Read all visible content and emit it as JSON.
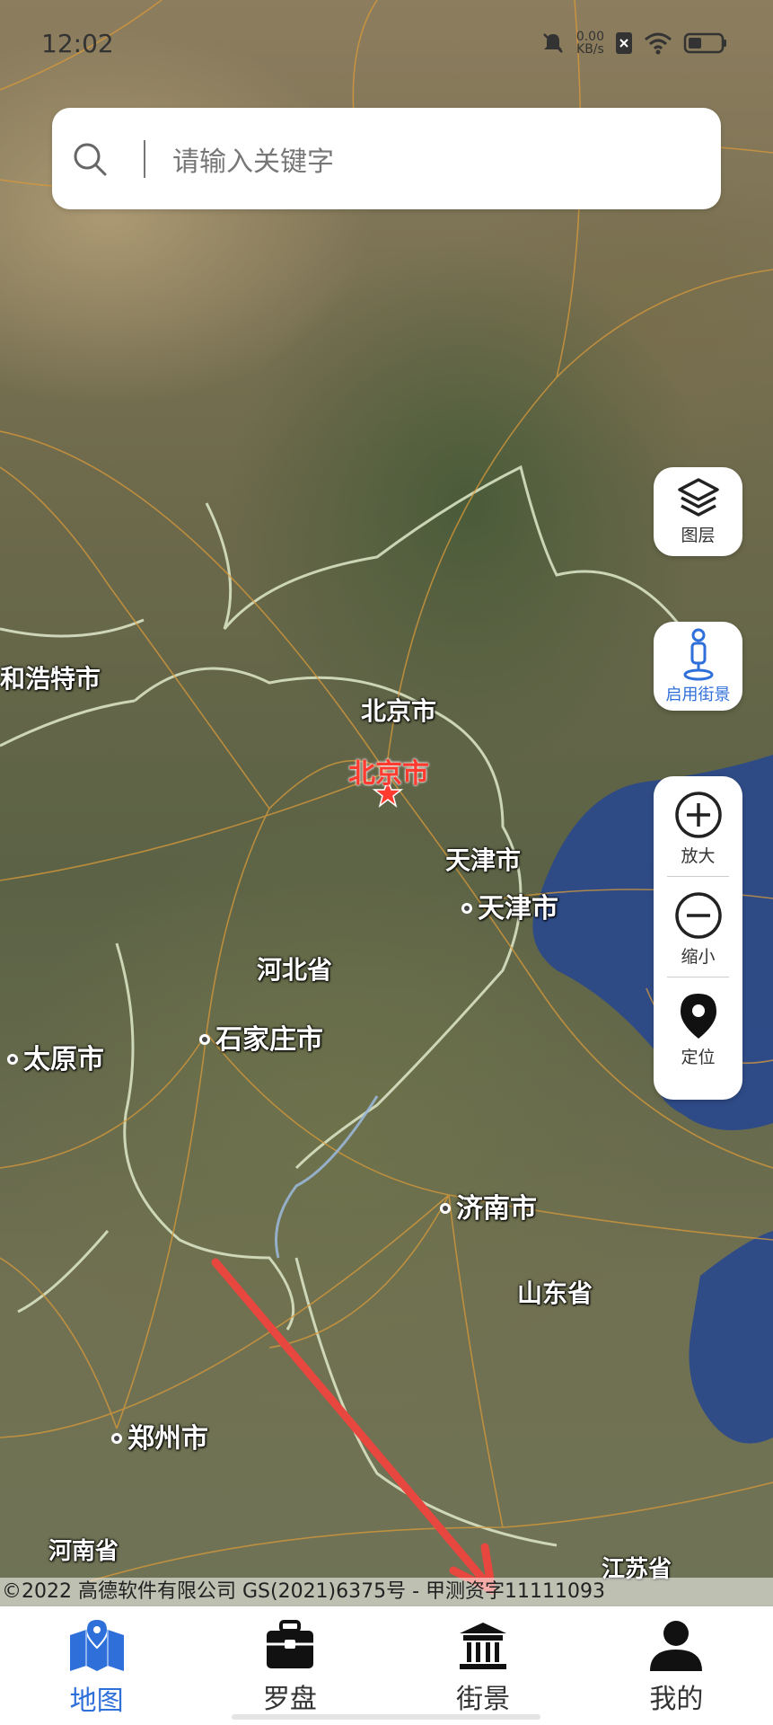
{
  "status_bar": {
    "time": "12:02",
    "net_speed_value": "0.00",
    "net_speed_unit": "KB/s",
    "battery_level": 0.3
  },
  "search": {
    "placeholder": "请输入关键字",
    "icon": "search-icon"
  },
  "map": {
    "labels": {
      "huhehaote": "和浩特市",
      "beijing_region": "北京市",
      "beijing_capital": "北京市",
      "tianjin_region": "天津市",
      "tianjin_city": "天津市",
      "hebei": "河北省",
      "shijiazhuang": "石家庄市",
      "taiyuan": "太原市",
      "jinan": "济南市",
      "shandong": "山东省",
      "zhengzhou": "郑州市",
      "henan": "河南省",
      "jiangsu": "江苏省"
    },
    "annotation_color": "#e8473f",
    "capital_color": "#ff3b30",
    "sea_color": "#2c4a8a"
  },
  "controls": {
    "layers": {
      "label": "图层",
      "icon": "layers-icon"
    },
    "street_view": {
      "label": "启用街景",
      "icon": "person-pin-icon",
      "color": "#2f6fd9"
    },
    "zoom_in": {
      "label": "放大",
      "icon": "plus-circle-icon"
    },
    "zoom_out": {
      "label": "缩小",
      "icon": "minus-circle-icon"
    },
    "locate": {
      "label": "定位",
      "icon": "location-pin-icon"
    }
  },
  "copyright": "©2022 高德软件有限公司 GS(2021)6375号 - 甲测资字11111093",
  "tabs": [
    {
      "label": "地图",
      "icon": "map-icon",
      "active": true
    },
    {
      "label": "罗盘",
      "icon": "toolbox-icon",
      "active": false
    },
    {
      "label": "街景",
      "icon": "temple-gate-icon",
      "active": false
    },
    {
      "label": "我的",
      "icon": "user-icon",
      "active": false
    }
  ],
  "accent_color": "#2f6fd9"
}
